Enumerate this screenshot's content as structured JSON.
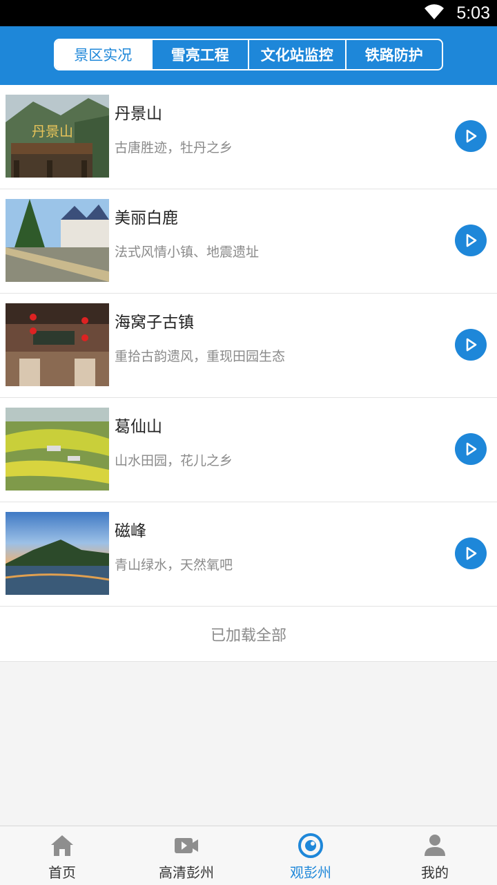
{
  "status_bar": {
    "time": "5:03"
  },
  "top_tabs": [
    {
      "label": "景区实况",
      "active": true
    },
    {
      "label": "雪亮工程",
      "active": false
    },
    {
      "label": "文化站监控",
      "active": false
    },
    {
      "label": "铁路防护",
      "active": false
    }
  ],
  "scenic_list": [
    {
      "title": "丹景山",
      "desc": "古唐胜迹，牡丹之乡",
      "thumb_text": "丹景山"
    },
    {
      "title": "美丽白鹿",
      "desc": "法式风情小镇、地震遗址"
    },
    {
      "title": "海窝子古镇",
      "desc": "重拾古韵遗风，重现田园生态"
    },
    {
      "title": "葛仙山",
      "desc": "山水田园，花儿之乡"
    },
    {
      "title": "磁峰",
      "desc": "青山绿水，天然氧吧"
    }
  ],
  "load_status": "已加载全部",
  "bottom_nav": [
    {
      "label": "首页",
      "icon": "home-icon"
    },
    {
      "label": "高清彭州",
      "icon": "video-camera-icon"
    },
    {
      "label": "观彭州",
      "icon": "eye-icon",
      "active": true
    },
    {
      "label": "我的",
      "icon": "person-icon"
    }
  ],
  "colors": {
    "accent": "#1e87d9",
    "muted_text": "#8a8a8a"
  }
}
